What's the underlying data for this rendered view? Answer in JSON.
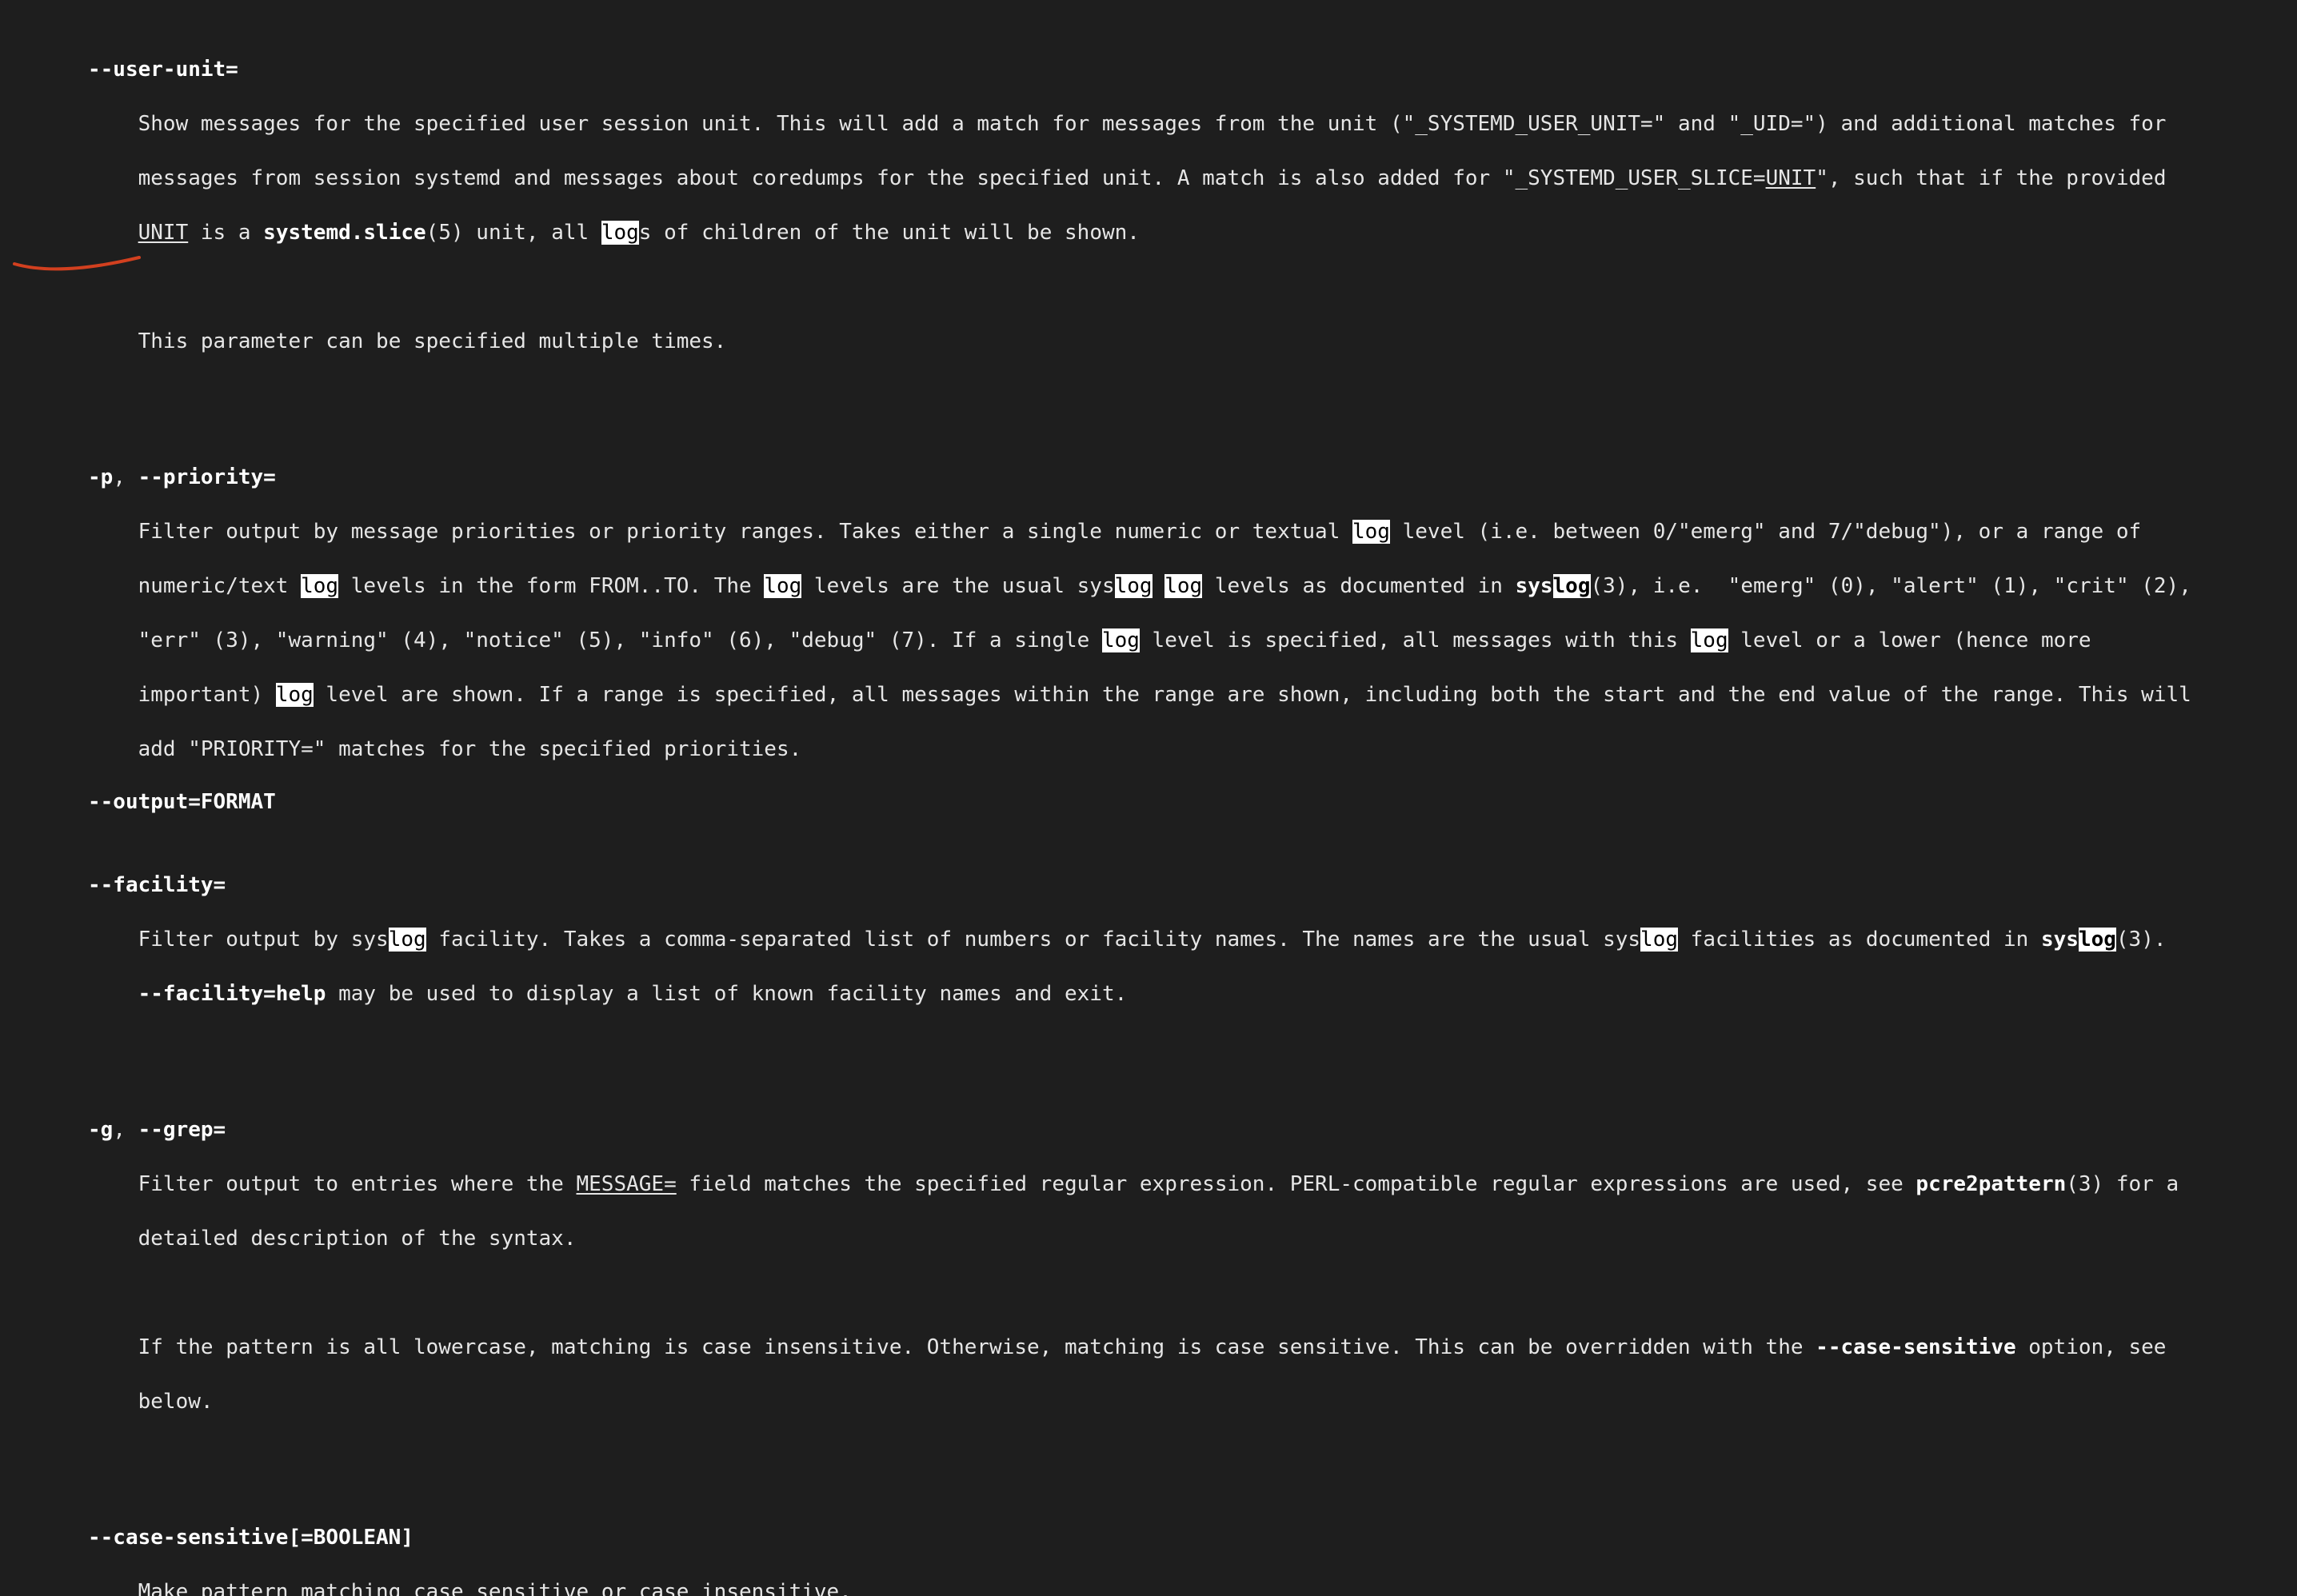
{
  "man_page": {
    "user_unit": {
      "option": "--user-unit=",
      "l1": "Show messages for the specified user session unit. This will add a match for messages from the unit (\"_SYSTEMD_USER_UNIT=\" and \"_UID=\") and additional matches for",
      "l2a": "messages from session systemd and messages about coredumps for the specified unit. A match is also added for \"_SYSTEMD_USER_SLICE=",
      "l2_unit": "UNIT",
      "l2b": "\", such that if the provided",
      "l3_unit": "UNIT",
      "l3a": " is a ",
      "l3_slice": "systemd.slice",
      "l3b": "(5) unit, all ",
      "l3_log": "log",
      "l3c": "s of children of the unit will be shown.",
      "p2": "This parameter can be specified multiple times."
    },
    "priority": {
      "opt_p": "-p",
      "sep": ", ",
      "opt_long": "--priority=",
      "l1a": "Filter output by message priorities or priority ranges. Takes either a single numeric or textual ",
      "l1_log": "log",
      "l1b": " level (i.e. between 0/\"emerg\" and 7/\"debug\"), or a range of",
      "l2a": "numeric/text ",
      "l2_log1": "log",
      "l2b": " levels in the form FROM..TO. The ",
      "l2_log2": "log",
      "l2c": " levels are the usual sys",
      "l2_log3": "log",
      "l2d": " ",
      "l2_log4": "log",
      "l2e": " levels as documented in ",
      "l2_sys": "sys",
      "l2_log5": "log",
      "l2f": "(3), i.e.  \"emerg\" (0), \"alert\" (1), \"crit\" (2),",
      "l3a": "\"err\" (3), \"warning\" (4), \"notice\" (5), \"info\" (6), \"debug\" (7). If a single ",
      "l3_log1": "log",
      "l3b": " level is specified, all messages with this ",
      "l3_log2": "log",
      "l3c": " level or a lower (hence more",
      "l4a": "important) ",
      "l4_log": "log",
      "l4b": " level are shown. If a range is specified, all messages within the range are shown, including both the start and the end value of the range. This will",
      "l5": "add \"PRIORITY=\" matches for the specified priorities."
    },
    "facility": {
      "option": "--facility=",
      "l1a": "Filter output by sys",
      "l1_log1": "log",
      "l1b": " facility. Takes a comma-separated list of numbers or facility names. The names are the usual sys",
      "l1_log2": "log",
      "l1c": " facilities as documented in ",
      "l1_sys": "sys",
      "l1_log3": "log",
      "l1d": "(3).",
      "l2_help": "--facility=help",
      "l2b": " may be used to display a list of known facility names and exit."
    },
    "grep": {
      "opt_g": "-g",
      "sep": ", ",
      "opt_long": "--grep=",
      "l1a": "Filter output to entries where the ",
      "l1_msg": "MESSAGE=",
      "l1b": " field matches the specified regular expression. PERL-compatible regular expressions are used, see ",
      "l1_pcre": "pcre2pattern",
      "l1c": "(3) for a",
      "l2": "detailed description of the syntax.",
      "p2a": "If the pattern is all lowercase, matching is case insensitive. Otherwise, matching is case sensitive. This can be overridden with the ",
      "p2_cs": "--case-sensitive",
      "p2b": " option, see",
      "p2c": "below."
    },
    "case_sensitive": {
      "option": "--case-sensitive[=BOOLEAN]",
      "l1": "Make pattern matching case sensitive or case insensitive."
    },
    "next_partial": "--output=FORMAT"
  },
  "colors": {
    "background": "#1e1e1e",
    "text": "#e6e6e6",
    "highlight_bg": "#ffffff",
    "highlight_fg": "#000000",
    "annotation_stroke": "#d2401f"
  }
}
